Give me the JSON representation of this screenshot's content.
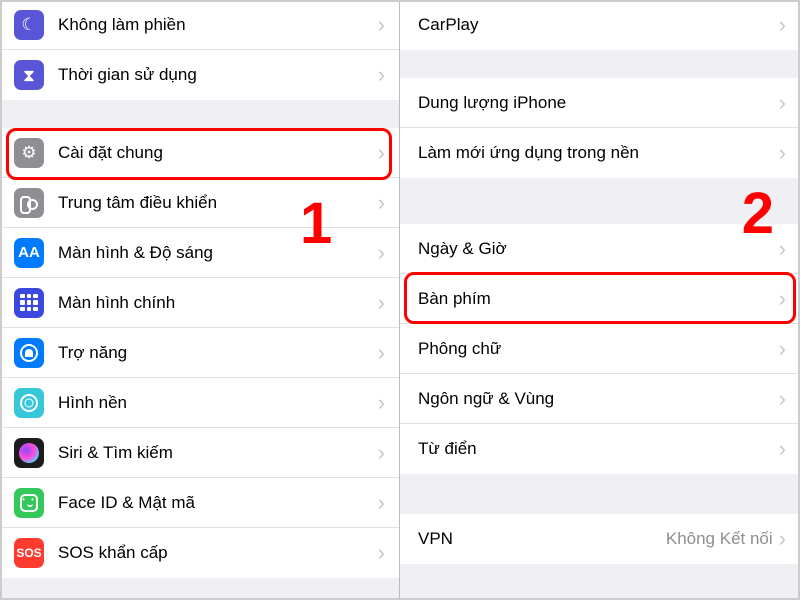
{
  "left": {
    "items": [
      {
        "label": "Không làm phiền",
        "icon": "moon"
      },
      {
        "label": "Thời gian sử dụng",
        "icon": "hourglass"
      }
    ],
    "group2": [
      {
        "label": "Cài đặt chung",
        "icon": "gear",
        "highlight": true
      },
      {
        "label": "Trung tâm điều khiển",
        "icon": "control"
      },
      {
        "label": "Màn hình & Độ sáng",
        "icon": "display"
      },
      {
        "label": "Màn hình chính",
        "icon": "home"
      },
      {
        "label": "Trợ năng",
        "icon": "access"
      },
      {
        "label": "Hình nền",
        "icon": "wallpaper"
      },
      {
        "label": "Siri & Tìm kiếm",
        "icon": "siri"
      },
      {
        "label": "Face ID & Mật mã",
        "icon": "faceid"
      },
      {
        "label": "SOS khẩn cấp",
        "icon": "sos"
      }
    ]
  },
  "right": {
    "group1": [
      {
        "label": "CarPlay"
      }
    ],
    "group2": [
      {
        "label": "Dung lượng iPhone"
      },
      {
        "label": "Làm mới ứng dụng trong nền"
      }
    ],
    "group3": [
      {
        "label": "Ngày & Giờ"
      },
      {
        "label": "Bàn phím",
        "highlight": true
      },
      {
        "label": "Phông chữ"
      },
      {
        "label": "Ngôn ngữ & Vùng"
      },
      {
        "label": "Từ điển"
      }
    ],
    "group4": [
      {
        "label": "VPN",
        "value": "Không Kết nối"
      }
    ]
  },
  "annotations": {
    "step1": "1",
    "step2": "2"
  }
}
